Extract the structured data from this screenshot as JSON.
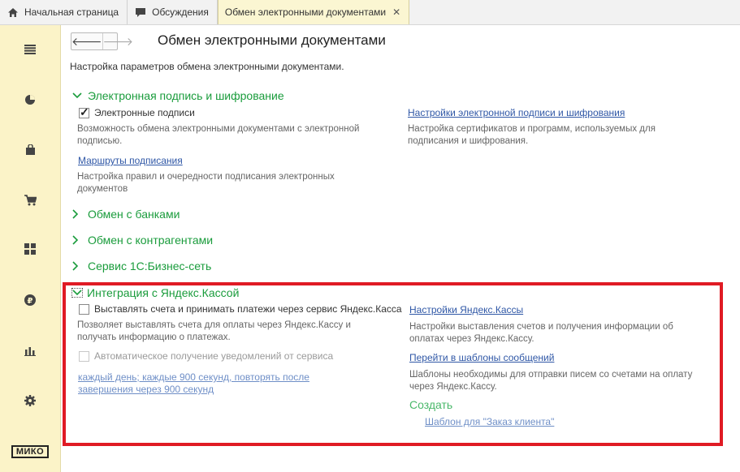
{
  "tabs": [
    {
      "label": "Начальная страница",
      "icon": "home-icon"
    },
    {
      "label": "Обсуждения",
      "icon": "chat-icon"
    },
    {
      "label": "Обмен электронными документами",
      "icon": "",
      "close": "✕"
    }
  ],
  "sidebar": {
    "items": [
      "menu-icon",
      "pie-chart-icon",
      "bag-icon",
      "cart-icon",
      "grid-icon",
      "ruble-icon",
      "bar-chart-icon",
      "gear-icon"
    ],
    "logo": "МИКО"
  },
  "page": {
    "title": "Обмен электронными документами",
    "subtitle": "Настройка параметров обмена электронными документами."
  },
  "signature": {
    "header": "Электронная подпись и шифрование",
    "checkbox_label": "Электронные подписи",
    "checkbox_desc_1": "Возможность обмена электронными документами с электронной",
    "checkbox_desc_2": "подписью.",
    "routes_link": "Маршруты подписания",
    "routes_desc_1": "Настройка правил и очередности подписания электронных",
    "routes_desc_2": "документов",
    "settings_link": "Настройки электронной подписи и шифрования",
    "settings_desc_1": "Настройка сертификатов и программ, используемых для",
    "settings_desc_2": "подписания и шифрования."
  },
  "groups": {
    "banks": "Обмен с банками",
    "contractors": "Обмен с контрагентами",
    "business_network": "Сервис 1С:Бизнес-сеть"
  },
  "yandex": {
    "header": "Интеграция с Яндекс.Кассой",
    "checkbox_label": "Выставлять счета и принимать платежи через сервис Яндекс.Касса",
    "checkbox_desc_1": "Позволяет выставлять счета для оплаты через Яндекс.Кассу и",
    "checkbox_desc_2": "получать информацию о платежах.",
    "auto_label": "Автоматическое получение уведомлений от сервиса",
    "schedule_1": "каждый день; каждые 900 секунд, повторять после",
    "schedule_2": "завершения через 900 секунд",
    "settings_link": "Настройки Яндекс.Кассы",
    "settings_desc_1": "Настройки выставления счетов и получения информации об",
    "settings_desc_2": "оплатах через Яндекс.Кассу.",
    "templates_link": "Перейти в шаблоны сообщений",
    "templates_desc_1": "Шаблоны необходимы для отправки писем со счетами на оплату",
    "templates_desc_2": "через Яндекс.Кассу.",
    "create_label": "Создать",
    "template_link": "Шаблон для \"Заказ клиента\""
  },
  "colors": {
    "accent_green": "#1a9c3c",
    "link_blue": "#2f57a6",
    "sidebar_bg": "#fbf3c8",
    "highlight_red": "#e01b24"
  }
}
